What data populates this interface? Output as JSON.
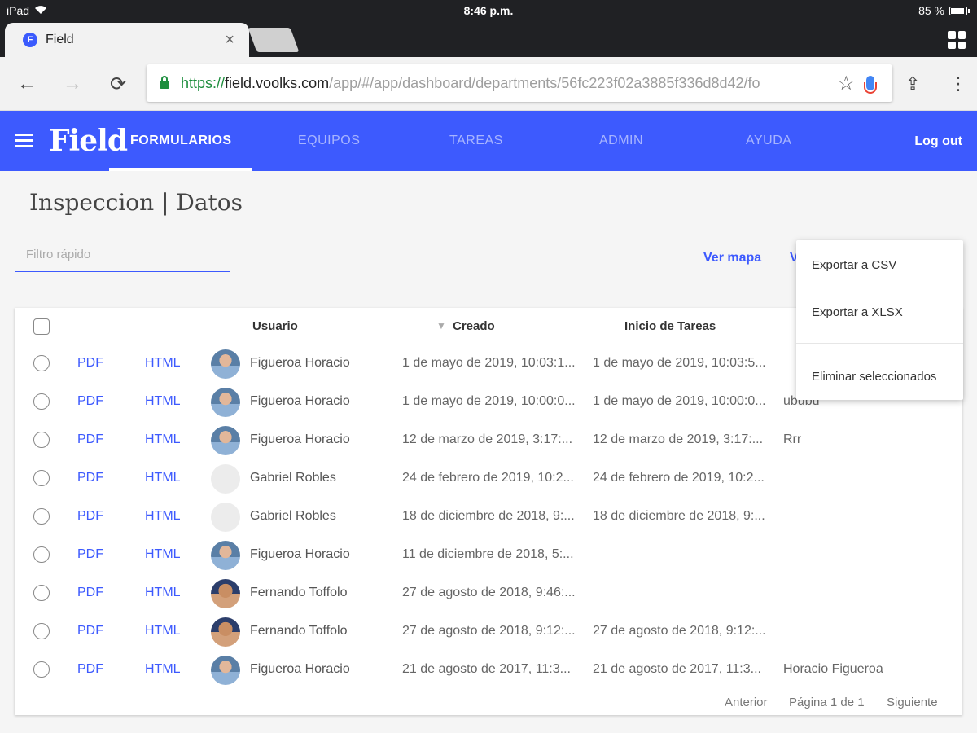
{
  "status_bar": {
    "device": "iPad",
    "time": "8:46 p.m.",
    "battery": "85 %"
  },
  "browser": {
    "tab_title": "Field",
    "tab_favicon": "F",
    "url_scheme": "https://",
    "url_host": "field.voolks.com",
    "url_path": "/app/#/app/dashboard/departments/56fc223f02a3885f336d8d42/fo"
  },
  "appbar": {
    "logo": "Field",
    "nav": [
      "FORMULARIOS",
      "EQUIPOS",
      "TAREAS",
      "ADMIN",
      "AYUDA"
    ],
    "logout": "Log out",
    "color": "#3d5afe"
  },
  "page": {
    "title": "Inspeccion | Datos",
    "filter_placeholder": "Filtro rápido",
    "ver_mapa": "Ver mapa",
    "ver_cut": "V"
  },
  "table": {
    "headers": {
      "user": "Usuario",
      "created": "Creado",
      "start": "Inicio de Tareas"
    },
    "pdf_label": "PDF",
    "html_label": "HTML",
    "rows": [
      {
        "avatar": "photo-a",
        "user": "Figueroa Horacio",
        "created": "1 de mayo de 2019, 10:03:1...",
        "start": "1 de mayo de 2019, 10:03:5...",
        "extra": ""
      },
      {
        "avatar": "photo-a",
        "user": "Figueroa Horacio",
        "created": "1 de mayo de 2019, 10:00:0...",
        "start": "1 de mayo de 2019, 10:00:0...",
        "extra": "ububu"
      },
      {
        "avatar": "photo-a",
        "user": "Figueroa Horacio",
        "created": "12 de marzo de 2019, 3:17:...",
        "start": "12 de marzo de 2019, 3:17:...",
        "extra": "Rrr"
      },
      {
        "avatar": "none",
        "user": "Gabriel Robles",
        "created": "24 de febrero de 2019, 10:2...",
        "start": "24 de febrero de 2019, 10:2...",
        "extra": ""
      },
      {
        "avatar": "none",
        "user": "Gabriel Robles",
        "created": "18 de diciembre de 2018, 9:...",
        "start": "18 de diciembre de 2018, 9:...",
        "extra": ""
      },
      {
        "avatar": "photo-a",
        "user": "Figueroa Horacio",
        "created": "11 de diciembre de 2018, 5:...",
        "start": "",
        "extra": ""
      },
      {
        "avatar": "photo-b",
        "user": "Fernando Toffolo",
        "created": "27 de agosto de 2018, 9:46:...",
        "start": "",
        "extra": ""
      },
      {
        "avatar": "photo-b",
        "user": "Fernando Toffolo",
        "created": "27 de agosto de 2018, 9:12:...",
        "start": "27 de agosto de 2018, 9:12:...",
        "extra": ""
      },
      {
        "avatar": "photo-a",
        "user": "Figueroa Horacio",
        "created": "21 de agosto de 2017, 11:3...",
        "start": "21 de agosto de 2017, 11:3...",
        "extra": "Horacio Figueroa"
      }
    ],
    "pager": {
      "prev": "Anterior",
      "page": "Página 1 de 1",
      "next": "Siguiente"
    }
  },
  "menu": {
    "items": [
      "Exportar a CSV",
      "Exportar a XLSX",
      "Eliminar seleccionados"
    ]
  }
}
